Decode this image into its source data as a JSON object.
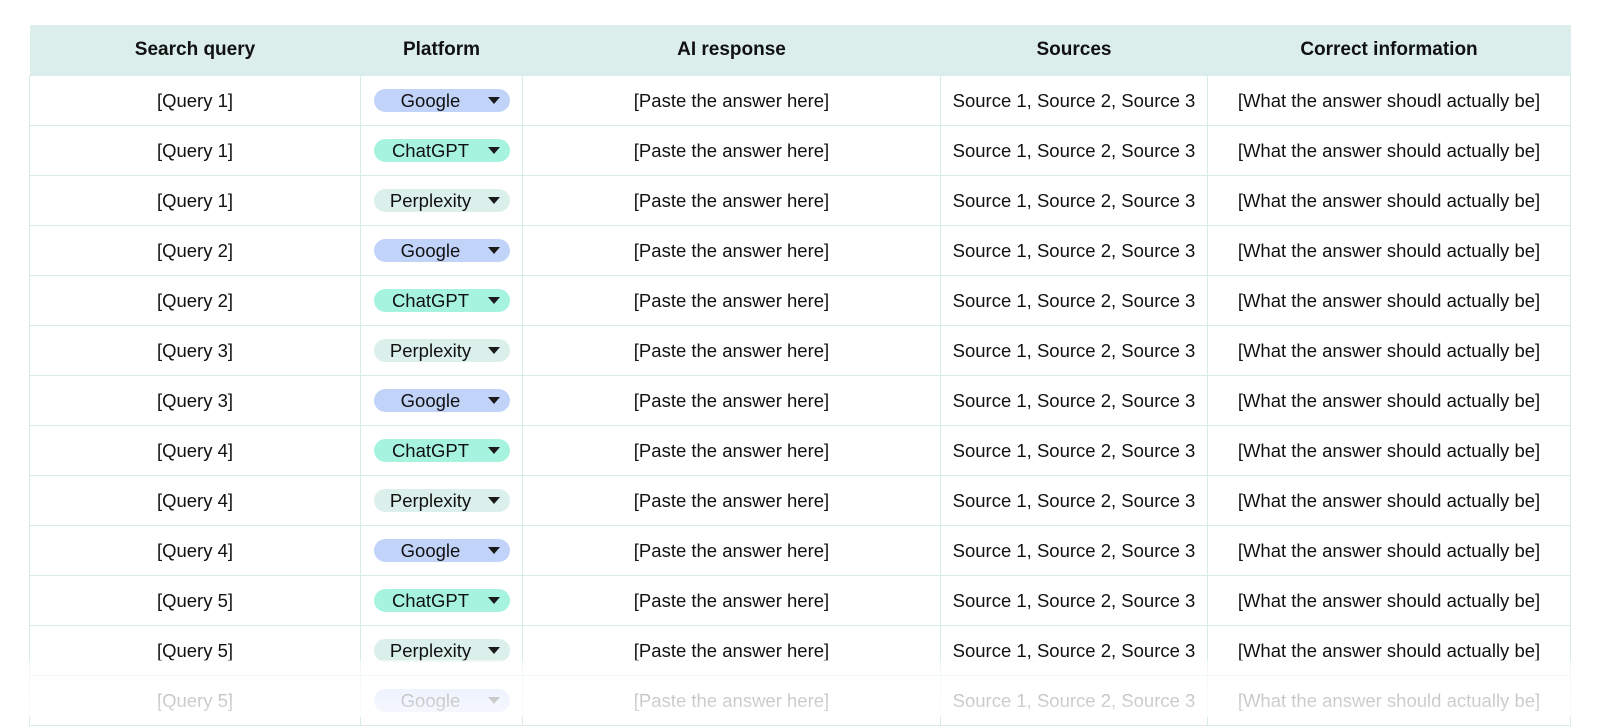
{
  "table": {
    "columns": [
      "Search query",
      "Platform",
      "AI response",
      "Sources",
      "Correct information"
    ],
    "platform_colors": {
      "Google": "#c2d3fa",
      "ChatGPT": "#a6f3e0",
      "Perplexity": "#dbefeb"
    },
    "rows": [
      {
        "query": "[Query 1]",
        "platform": "Google",
        "response": "[Paste the answer here]",
        "sources": "Source 1, Source 2, Source 3",
        "correct": "[What the answer shoudl actually be]"
      },
      {
        "query": "[Query 1]",
        "platform": "ChatGPT",
        "response": "[Paste the answer here]",
        "sources": "Source 1, Source 2, Source 3",
        "correct": "[What the answer should actually be]"
      },
      {
        "query": "[Query 1]",
        "platform": "Perplexity",
        "response": "[Paste the answer here]",
        "sources": "Source 1, Source 2, Source 3",
        "correct": "[What the answer should actually be]"
      },
      {
        "query": "[Query 2]",
        "platform": "Google",
        "response": "[Paste the answer here]",
        "sources": "Source 1, Source 2, Source 3",
        "correct": "[What the answer should actually be]"
      },
      {
        "query": "[Query 2]",
        "platform": "ChatGPT",
        "response": "[Paste the answer here]",
        "sources": "Source 1, Source 2, Source 3",
        "correct": "[What the answer should actually be]"
      },
      {
        "query": "[Query 3]",
        "platform": "Perplexity",
        "response": "[Paste the answer here]",
        "sources": "Source 1, Source 2, Source 3",
        "correct": "[What the answer should actually be]"
      },
      {
        "query": "[Query 3]",
        "platform": "Google",
        "response": "[Paste the answer here]",
        "sources": "Source 1, Source 2, Source 3",
        "correct": "[What the answer should actually be]"
      },
      {
        "query": "[Query 4]",
        "platform": "ChatGPT",
        "response": "[Paste the answer here]",
        "sources": "Source 1, Source 2, Source 3",
        "correct": "[What the answer should actually be]"
      },
      {
        "query": "[Query 4]",
        "platform": "Perplexity",
        "response": "[Paste the answer here]",
        "sources": "Source 1, Source 2, Source 3",
        "correct": "[What the answer should actually be]"
      },
      {
        "query": "[Query 4]",
        "platform": "Google",
        "response": "[Paste the answer here]",
        "sources": "Source 1, Source 2, Source 3",
        "correct": "[What the answer should actually be]"
      },
      {
        "query": "[Query 5]",
        "platform": "ChatGPT",
        "response": "[Paste the answer here]",
        "sources": "Source 1, Source 2, Source 3",
        "correct": "[What the answer should actually be]"
      },
      {
        "query": "[Query 5]",
        "platform": "Perplexity",
        "response": "[Paste the answer here]",
        "sources": "Source 1, Source 2, Source 3",
        "correct": "[What the answer should actually be]"
      },
      {
        "query": "[Query 5]",
        "platform": "Google",
        "response": "[Paste the answer here]",
        "sources": "Source 1, Source 2, Source 3",
        "correct": "[What the answer should actually be]"
      }
    ]
  }
}
